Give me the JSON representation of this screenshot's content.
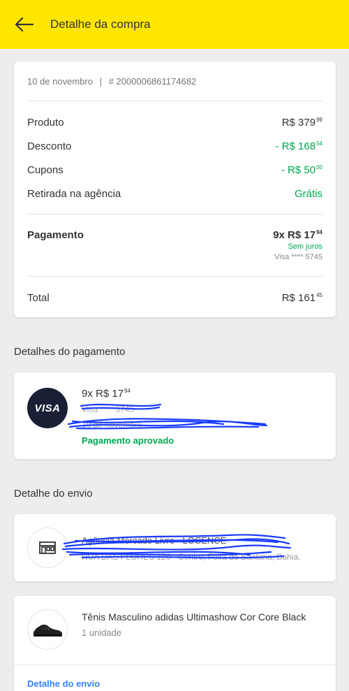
{
  "header": {
    "title": "Detalhe da compra"
  },
  "summary": {
    "date": "10 de novembro",
    "separator": "|",
    "order_id": "# 2000006861174682",
    "rows": [
      {
        "label": "Produto",
        "value_main": "R$ 379",
        "value_cents": "99"
      },
      {
        "label": "Desconto",
        "value_main": "- R$ 168",
        "value_cents": "54"
      },
      {
        "label": "Cupons",
        "value_main": "- R$ 50",
        "value_cents": "00"
      },
      {
        "label": "Retirada na agência",
        "value_main": "Grátis",
        "value_cents": ""
      }
    ],
    "payment": {
      "label": "Pagamento",
      "value_main": "9x R$ 17",
      "value_cents": "94",
      "interest": "Sem juros",
      "card": "Visa **** 5745"
    },
    "total": {
      "label": "Total",
      "value_main": "R$ 161",
      "value_cents": "45"
    }
  },
  "payment_details": {
    "title": "Detalhes do pagamento",
    "brand": "VISA",
    "installments_main": "9x R$ 17",
    "installments_cents": "94",
    "card_line": "Visa **** 5745",
    "date_line": "10 de novembro",
    "status": "Pagamento aprovado"
  },
  "shipping": {
    "title": "Detalhe do envio",
    "agency_name": "Agência Mercado Livre - LOCENCE",
    "agency_address": "RUA DAS FLORES 120 - Centro, Feira de Santana, Bahia."
  },
  "product": {
    "name": "Tênis Masculino adidas Ultimashow Cor Core Black",
    "quantity": "1 unidade",
    "link": "Detalhe do envio"
  },
  "colors": {
    "header_bg": "#ffe600",
    "green": "#00a650",
    "link_blue": "#3483fa",
    "scribble_blue": "#1a3cff"
  }
}
